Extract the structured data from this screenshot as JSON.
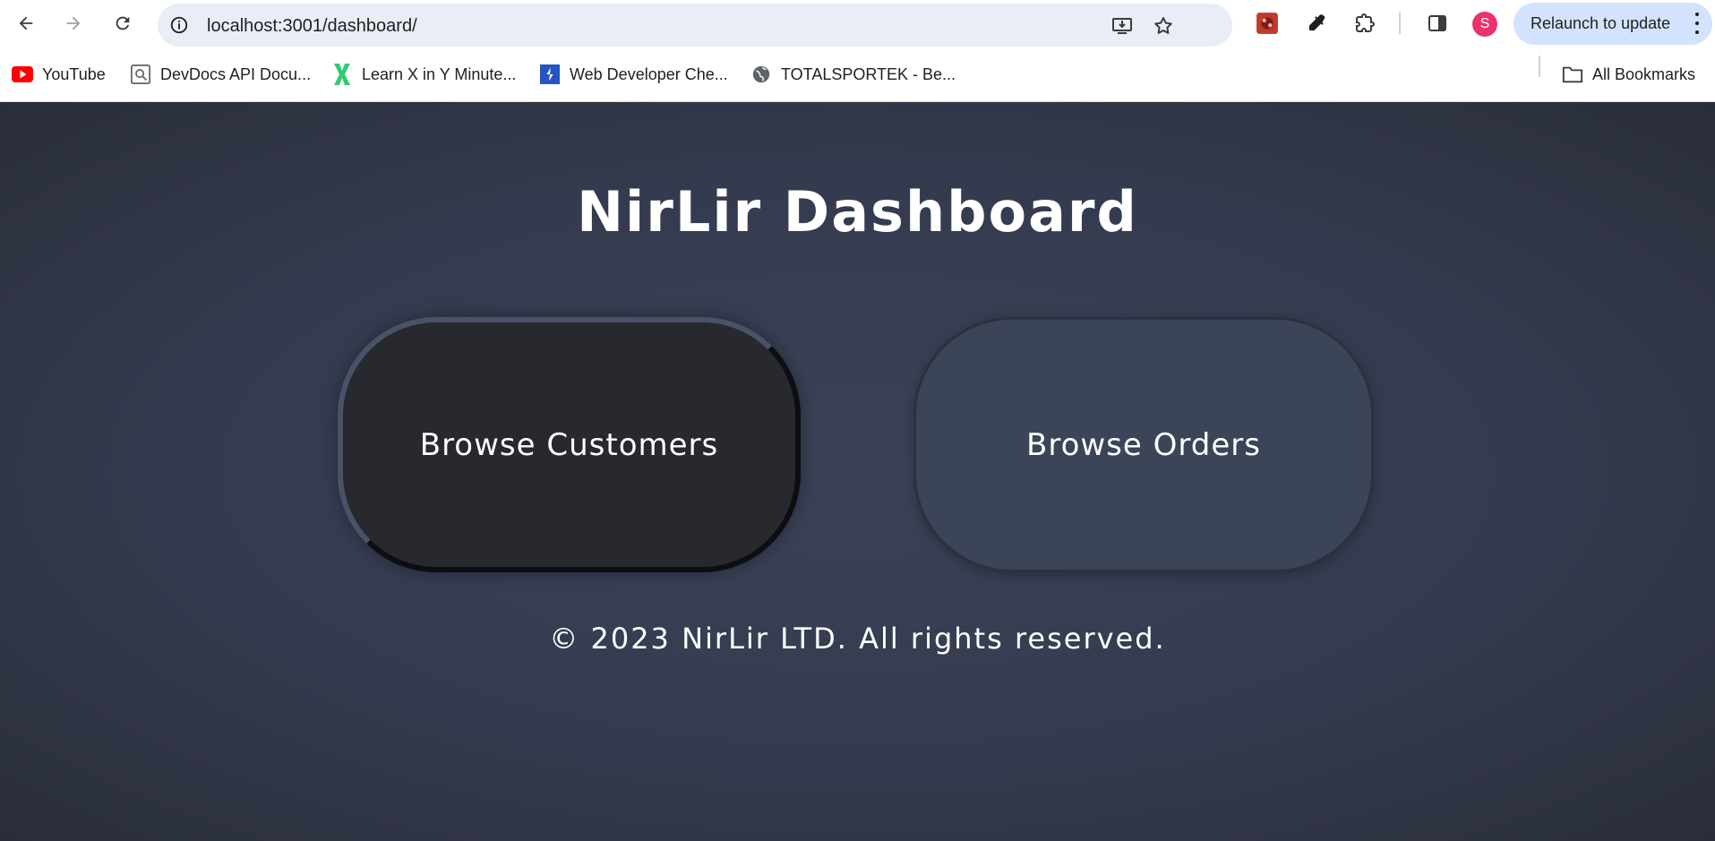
{
  "browser": {
    "url": "localhost:3001/dashboard/",
    "relaunch_label": "Relaunch to update",
    "profile_initial": "S",
    "bookmarks": [
      {
        "label": "YouTube",
        "icon": "youtube-icon"
      },
      {
        "label": "DevDocs API Docu...",
        "icon": "devdocs-icon"
      },
      {
        "label": "Learn X in Y Minute...",
        "icon": "learnx-icon"
      },
      {
        "label": "Web Developer Che...",
        "icon": "webdev-icon"
      },
      {
        "label": "TOTALSPORTEK - Be...",
        "icon": "globe-icon"
      }
    ],
    "all_bookmarks_label": "All Bookmarks"
  },
  "page": {
    "title": "NirLir Dashboard",
    "buttons": {
      "customers": "Browse Customers",
      "orders": "Browse Orders"
    },
    "footer": "© 2023 NirLir LTD. All rights reserved."
  },
  "colors": {
    "background": "#353b4f",
    "customers_button": "#28292e",
    "orders_button": "#3c4458",
    "profile": "#e8336d",
    "relaunch_bg": "#d3e3fd"
  }
}
